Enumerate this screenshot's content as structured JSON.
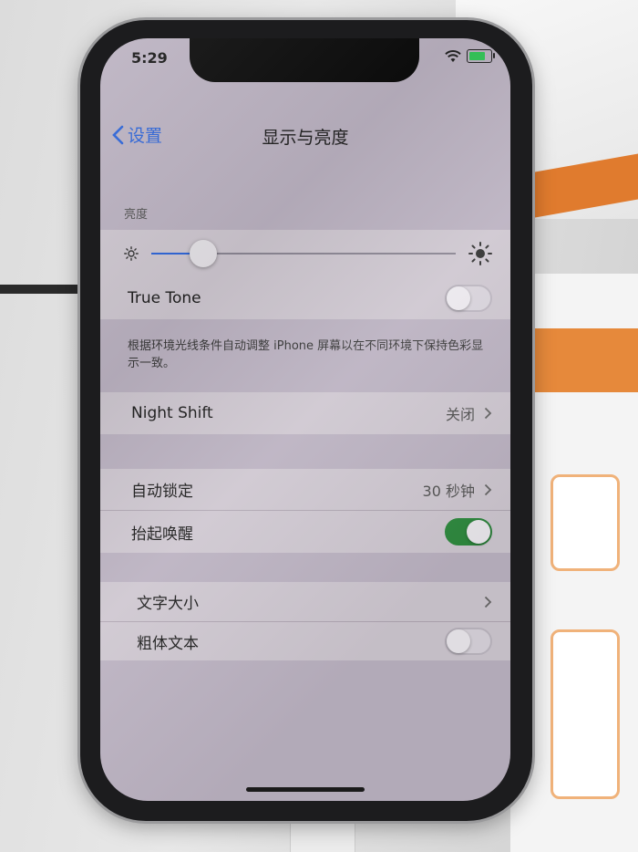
{
  "status_bar": {
    "time": "5:29"
  },
  "nav": {
    "back_label": "设置",
    "title": "显示与亮度"
  },
  "brightness": {
    "section_label": "亮度",
    "level": 0.17
  },
  "true_tone": {
    "label": "True Tone",
    "on": false,
    "footnote": "根据环境光线条件自动调整 iPhone 屏幕以在不同环境下保持色彩显示一致。"
  },
  "night_shift": {
    "label": "Night Shift",
    "value": "关闭"
  },
  "lock": {
    "auto_lock_label": "自动锁定",
    "auto_lock_value": "30 秒钟",
    "raise_to_wake_label": "抬起唤醒",
    "raise_to_wake_on": true
  },
  "text": {
    "text_size_label": "文字大小",
    "bold_text_label": "粗体文本",
    "bold_on": false
  },
  "colors": {
    "accent": "#2f66d9",
    "toggle_on": "#2f8a3f"
  }
}
